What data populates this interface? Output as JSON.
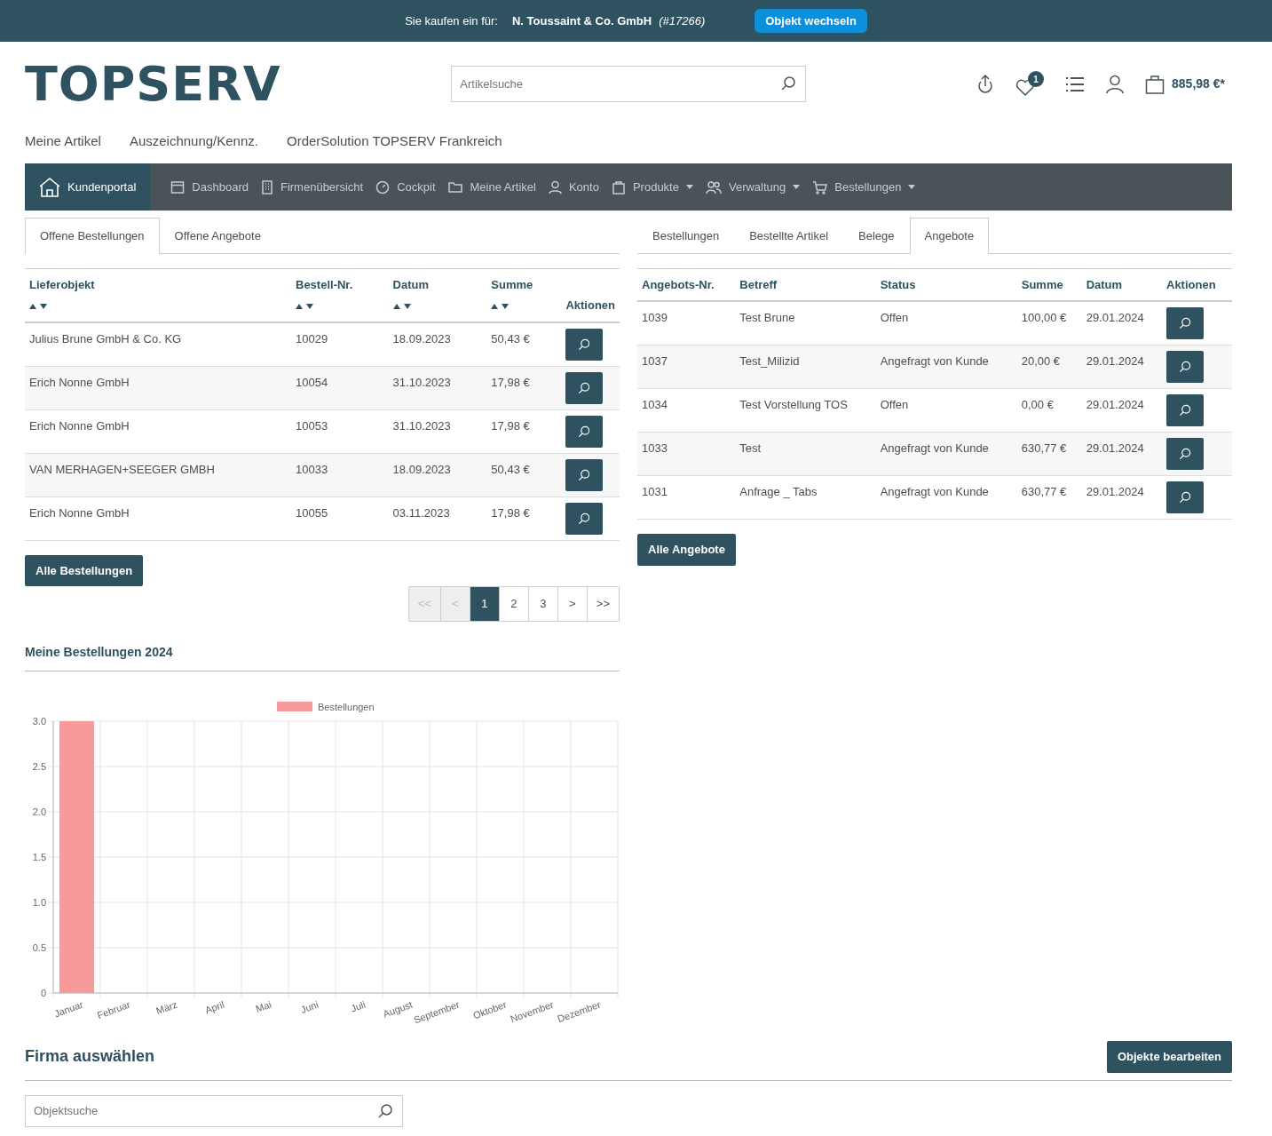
{
  "topbar": {
    "label": "Sie kaufen ein für:",
    "company": "N. Toussaint & Co. GmbH",
    "company_id": "(#17266)",
    "button": "Objekt wechseln"
  },
  "header": {
    "logo": "TOPSERV",
    "search": {
      "placeholder": "Artikelsuche"
    },
    "wishlist_count": "1",
    "cart_total": "885,98 €*"
  },
  "links": [
    "Meine Artikel",
    "Auszeichnung/Kennz.",
    "OrderSolution TOPSERV Frankreich"
  ],
  "portal_nav": {
    "brand": "Kundenportal",
    "items": [
      {
        "label": "Dashboard",
        "dropdown": false
      },
      {
        "label": "Firmenübersicht",
        "dropdown": false
      },
      {
        "label": "Cockpit",
        "dropdown": false
      },
      {
        "label": "Meine Artikel",
        "dropdown": false
      },
      {
        "label": "Konto",
        "dropdown": false
      },
      {
        "label": "Produkte",
        "dropdown": true
      },
      {
        "label": "Verwaltung",
        "dropdown": true
      },
      {
        "label": "Bestellungen",
        "dropdown": true
      }
    ]
  },
  "orders_panel": {
    "tabs": [
      {
        "label": "Offene Bestellungen",
        "selected": true
      },
      {
        "label": "Offene Angebote",
        "selected": false
      }
    ],
    "columns": [
      {
        "label": "Lieferobjekt",
        "sortable": true
      },
      {
        "label": "Bestell-Nr.",
        "sortable": true
      },
      {
        "label": "Datum",
        "sortable": true
      },
      {
        "label": "Summe",
        "sortable": true
      },
      {
        "label": "Aktionen",
        "sortable": false
      }
    ],
    "rows": [
      [
        "Julius Brune GmbH & Co. KG",
        "10029",
        "18.09.2023",
        "50,43 €"
      ],
      [
        "Erich Nonne GmbH",
        "10054",
        "31.10.2023",
        "17,98 €"
      ],
      [
        "Erich Nonne GmbH",
        "10053",
        "31.10.2023",
        "17,98 €"
      ],
      [
        "VAN MERHAGEN+SEEGER GMBH",
        "10033",
        "18.09.2023",
        "50,43 €"
      ],
      [
        "Erich Nonne GmbH",
        "10055",
        "03.11.2023",
        "17,98 €"
      ]
    ],
    "button": "Alle Bestellungen",
    "pagination": [
      {
        "label": "<<",
        "disabled": true,
        "selected": false
      },
      {
        "label": "<",
        "disabled": true,
        "selected": false
      },
      {
        "label": "1",
        "disabled": false,
        "selected": true
      },
      {
        "label": "2",
        "disabled": false,
        "selected": false
      },
      {
        "label": "3",
        "disabled": false,
        "selected": false
      },
      {
        "label": ">",
        "disabled": false,
        "selected": false
      },
      {
        "label": ">>",
        "disabled": false,
        "selected": false
      }
    ]
  },
  "offers_panel": {
    "tabs": [
      {
        "label": "Bestellungen",
        "selected": false
      },
      {
        "label": "Bestellte Artikel",
        "selected": false
      },
      {
        "label": "Belege",
        "selected": false
      },
      {
        "label": "Angebote",
        "selected": true
      }
    ],
    "columns": [
      "Angebots-Nr.",
      "Betreff",
      "Status",
      "Summe",
      "Datum",
      "Aktionen"
    ],
    "rows": [
      [
        "1039",
        "Test Brune",
        "Offen",
        "100,00 €",
        "29.01.2024"
      ],
      [
        "1037",
        "Test_Milizid",
        "Angefragt von Kunde",
        "20,00 €",
        "29.01.2024"
      ],
      [
        "1034",
        "Test Vorstellung TOS",
        "Offen",
        "0,00 €",
        "29.01.2024"
      ],
      [
        "1033",
        "Test",
        "Angefragt von Kunde",
        "630,77 €",
        "29.01.2024"
      ],
      [
        "1031",
        "Anfrage _ Tabs",
        "Angefragt von Kunde",
        "630,77 €",
        "29.01.2024"
      ]
    ],
    "button": "Alle Angebote"
  },
  "chart_section": {
    "title": "Meine Bestellungen 2024",
    "chart_data": {
      "type": "bar",
      "categories": [
        "Januar",
        "Februar",
        "März",
        "April",
        "Mai",
        "Juni",
        "Juli",
        "August",
        "September",
        "Oktober",
        "November",
        "Dezember"
      ],
      "series": [
        {
          "name": "Bestellungen",
          "color": "#f89a9a",
          "values": [
            3,
            0,
            0,
            0,
            0,
            0,
            0,
            0,
            0,
            0,
            0,
            0
          ]
        }
      ],
      "ylim": [
        0,
        3
      ],
      "grid": true,
      "yticks": [
        {
          "value": 0,
          "label": "0"
        },
        0.5,
        {
          "value": 1,
          "label": "1.0"
        },
        1.5,
        {
          "value": 2,
          "label": "2.0"
        },
        2.5,
        {
          "value": 3,
          "label": "3.0"
        }
      ]
    }
  },
  "company_section": {
    "title": "Firma auswählen",
    "button": "Objekte bearbeiten",
    "search": {
      "placeholder": "Objektsuche"
    }
  }
}
